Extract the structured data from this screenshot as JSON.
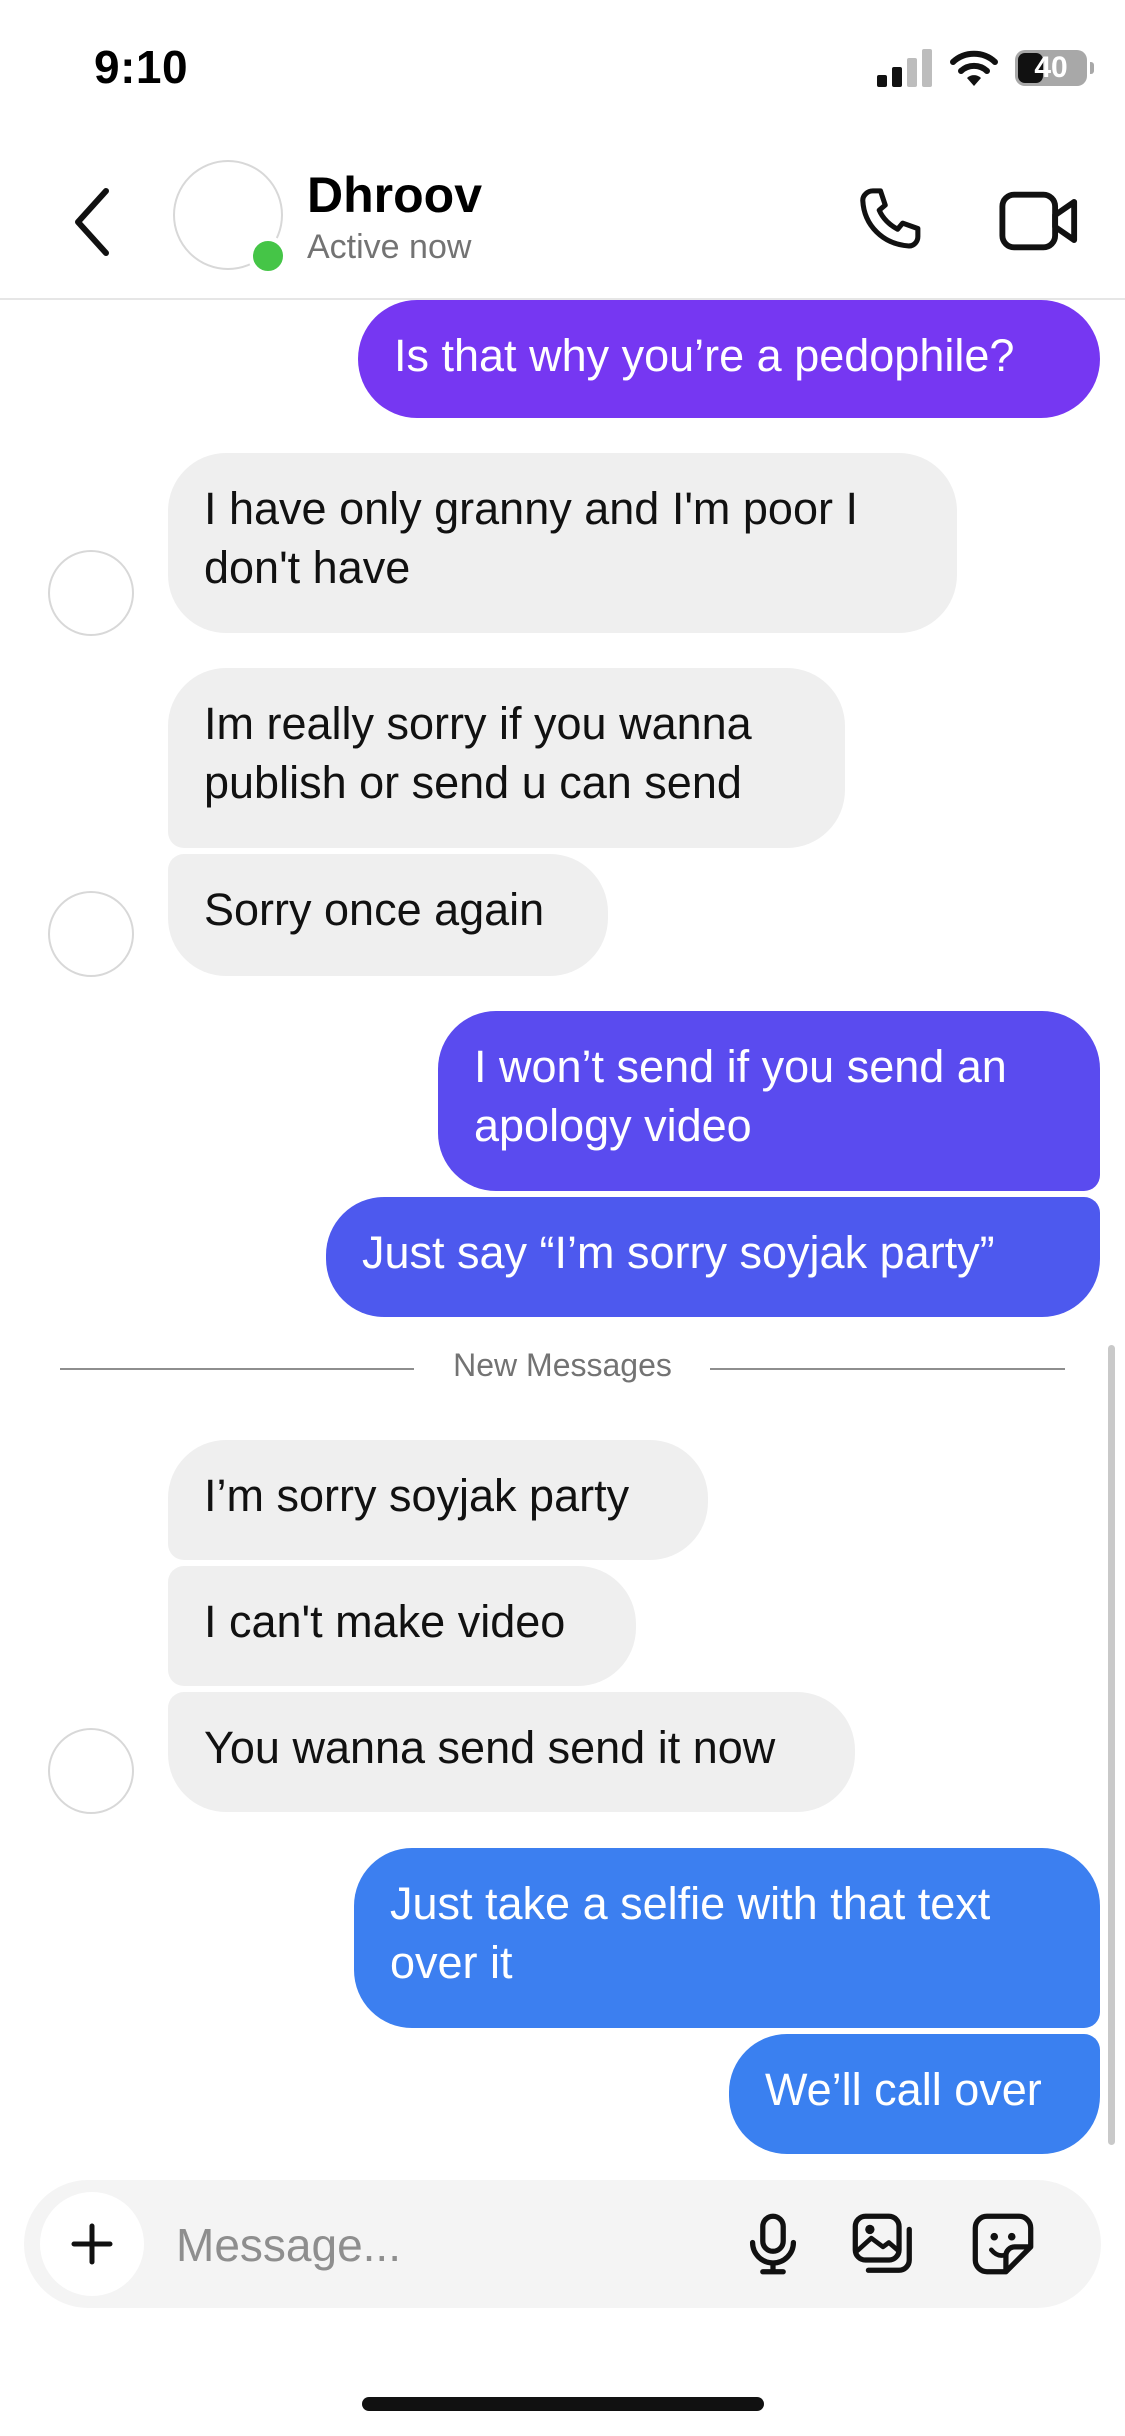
{
  "status_bar": {
    "time": "9:10",
    "battery": "40"
  },
  "header": {
    "contact_name": "Dhroov",
    "status": "Active now"
  },
  "messages": [
    {
      "side": "out",
      "text": "Is that why you’re a pedophile?"
    },
    {
      "side": "in",
      "text": "I have only granny and I'm poor I don't have"
    },
    {
      "side": "in",
      "text": "Im really sorry if you wanna publish or send u can send"
    },
    {
      "side": "in",
      "text": "Sorry once again"
    },
    {
      "side": "out",
      "text": "I won’t send if you send an apology video"
    },
    {
      "side": "out",
      "text": "Just say “I’m sorry soyjak party”"
    },
    {
      "side": "in",
      "text": "I’m sorry soyjak party"
    },
    {
      "side": "in",
      "text": "I can't make video"
    },
    {
      "side": "in",
      "text": "You wanna send send it now"
    },
    {
      "side": "out",
      "text": "Just take a selfie with that text over it"
    },
    {
      "side": "out",
      "text": "We’ll call over"
    }
  ],
  "divider_label": "New Messages",
  "composer": {
    "placeholder": "Message..."
  },
  "icons": {
    "back": "chevron-left-icon",
    "call": "phone-icon",
    "video": "video-camera-icon",
    "add": "plus-icon",
    "mic": "microphone-icon",
    "gallery": "gallery-icon",
    "sticker": "sticker-icon"
  },
  "colors": {
    "incoming_bubble": "#efefef",
    "outgoing_top": "#7637f2",
    "outgoing_bottom": "#3a80f0",
    "online": "#45c547"
  }
}
